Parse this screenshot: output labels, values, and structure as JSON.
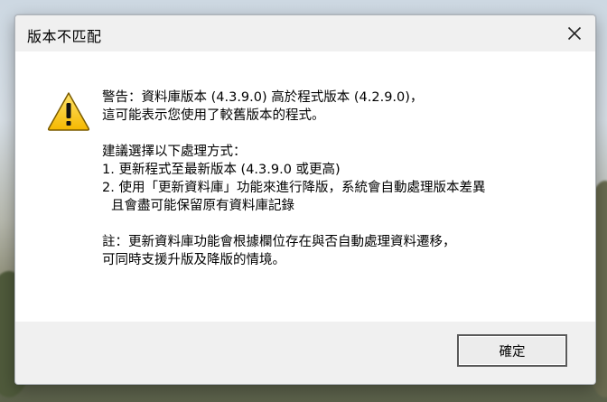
{
  "dialog": {
    "title": "版本不匹配",
    "close_icon": "close-icon",
    "warning_icon": "warning-icon",
    "message": {
      "line1": "警告：資料庫版本 (4.3.9.0) 高於程式版本 (4.2.9.0)，",
      "line2": "這可能表示您使用了較舊版本的程式。",
      "line3": "建議選擇以下處理方式：",
      "line4": "1. 更新程式至最新版本 (4.3.9.0 或更高)",
      "line5": "2. 使用「更新資料庫」功能來進行降版，系統會自動處理版本差異",
      "line6": "且會盡可能保留原有資料庫記錄",
      "line7": "註：更新資料庫功能會根據欄位存在與否自動處理資料遷移，",
      "line8": "可同時支援升版及降版的情境。"
    },
    "ok_label": "確定"
  }
}
